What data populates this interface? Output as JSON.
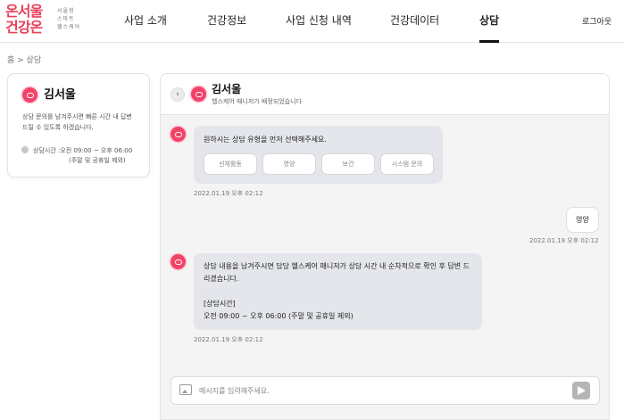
{
  "logo": {
    "main": "온서울\n건강온",
    "sub": "서울형\n스마트\n헬스케어"
  },
  "nav": [
    {
      "label": "사업 소개"
    },
    {
      "label": "건강정보"
    },
    {
      "label": "사업 신청 내역"
    },
    {
      "label": "건강데이터"
    },
    {
      "label": "상담"
    }
  ],
  "header": {
    "logout_label": "로그아웃"
  },
  "breadcrumb": "홈 > 상담",
  "profile": {
    "name": "김서울",
    "description": "상담 문의를 남겨주시면 빠른 시간 내 답변 드릴 수 있도록 하겠습니다.",
    "hours": "상담시간 :오전 09:00 ~ 오후 06:00",
    "hours_note": "(주말 및 공휴일 제외)"
  },
  "chat": {
    "name": "김서울",
    "subtitle": "헬스케어 매니저가 배정되었습니다",
    "messages": {
      "prompt": "원하시는 상담 유형을 먼저 선택해주세요.",
      "options": [
        "신체활동",
        "영양",
        "보건",
        "시스템 문의"
      ],
      "prompt_time": "2022.01.19 오후 02:12",
      "user_reply": "영양",
      "user_time": "2022.01.19 오후 02:12",
      "answer": "상담 내용을 남겨주시면 담당 헬스케어 매니저가 상담 시간 내 순차적으로 확인 후 답변 드리겠습니다.\n\n[상담시간]\n오전 09:00 ~ 오후 06:00 (주말 및 공휴일 제외)",
      "answer_time": "2022.01.19 오후 02:12"
    },
    "input_placeholder": "메시지를 입력해주세요."
  },
  "colors": {
    "brand": "#e8405a",
    "avatar": "#f0436a",
    "bubble": "#e4e6ec"
  }
}
